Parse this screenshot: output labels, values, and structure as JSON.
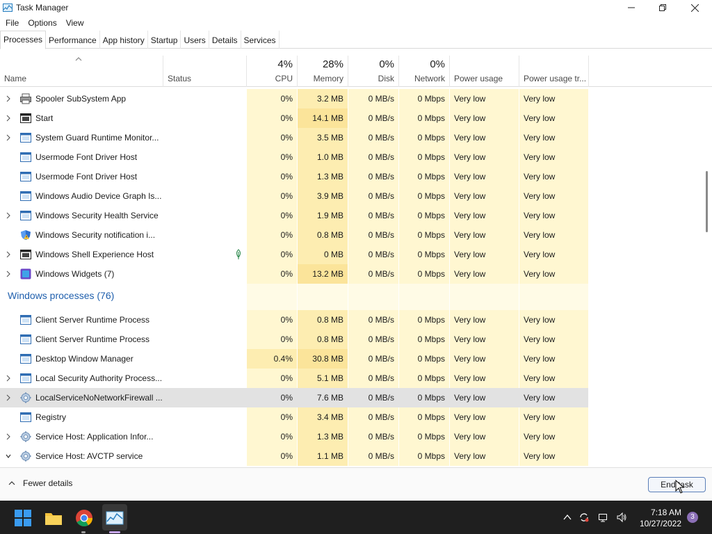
{
  "window": {
    "title": "Task Manager"
  },
  "menu": [
    "File",
    "Options",
    "View"
  ],
  "tabs": [
    "Processes",
    "Performance",
    "App history",
    "Startup",
    "Users",
    "Details",
    "Services"
  ],
  "columns": {
    "name": "Name",
    "status": "Status",
    "cpu": {
      "label": "CPU",
      "pct": "4%"
    },
    "memory": {
      "label": "Memory",
      "pct": "28%"
    },
    "disk": {
      "label": "Disk",
      "pct": "0%"
    },
    "network": {
      "label": "Network",
      "pct": "0%"
    },
    "power": "Power usage",
    "power_trend": "Power usage tr..."
  },
  "rows": [
    {
      "name": "Spooler SubSystem App",
      "expand": true,
      "icon": "printer-icon",
      "cpu": "0%",
      "mem": "3.2 MB",
      "disk": "0 MB/s",
      "net": "0 Mbps",
      "power": "Very low",
      "power_trend": "Very low"
    },
    {
      "name": "Start",
      "expand": true,
      "icon": "app-window-dark-icon",
      "cpu": "0%",
      "mem": "14.1 MB",
      "disk": "0 MB/s",
      "net": "0 Mbps",
      "power": "Very low",
      "power_trend": "Very low"
    },
    {
      "name": "System Guard Runtime Monitor...",
      "expand": true,
      "icon": "app-window-icon",
      "cpu": "0%",
      "mem": "3.5 MB",
      "disk": "0 MB/s",
      "net": "0 Mbps",
      "power": "Very low",
      "power_trend": "Very low"
    },
    {
      "name": "Usermode Font Driver Host",
      "expand": false,
      "icon": "app-window-icon",
      "cpu": "0%",
      "mem": "1.0 MB",
      "disk": "0 MB/s",
      "net": "0 Mbps",
      "power": "Very low",
      "power_trend": "Very low"
    },
    {
      "name": "Usermode Font Driver Host",
      "expand": false,
      "icon": "app-window-icon",
      "cpu": "0%",
      "mem": "1.3 MB",
      "disk": "0 MB/s",
      "net": "0 Mbps",
      "power": "Very low",
      "power_trend": "Very low"
    },
    {
      "name": "Windows Audio Device Graph Is...",
      "expand": false,
      "icon": "app-window-icon",
      "cpu": "0%",
      "mem": "3.9 MB",
      "disk": "0 MB/s",
      "net": "0 Mbps",
      "power": "Very low",
      "power_trend": "Very low"
    },
    {
      "name": "Windows Security Health Service",
      "expand": true,
      "icon": "app-window-icon",
      "cpu": "0%",
      "mem": "1.9 MB",
      "disk": "0 MB/s",
      "net": "0 Mbps",
      "power": "Very low",
      "power_trend": "Very low"
    },
    {
      "name": "Windows Security notification i...",
      "expand": false,
      "icon": "shield-icon",
      "cpu": "0%",
      "mem": "0.8 MB",
      "disk": "0 MB/s",
      "net": "0 Mbps",
      "power": "Very low",
      "power_trend": "Very low"
    },
    {
      "name": "Windows Shell Experience Host",
      "expand": true,
      "icon": "app-window-dark-icon",
      "leaf": true,
      "cpu": "0%",
      "mem": "0 MB",
      "disk": "0 MB/s",
      "net": "0 Mbps",
      "power": "Very low",
      "power_trend": "Very low"
    },
    {
      "name": "Windows Widgets (7)",
      "expand": true,
      "icon": "widgets-icon",
      "cpu": "0%",
      "mem": "13.2 MB",
      "disk": "0 MB/s",
      "net": "0 Mbps",
      "power": "Very low",
      "power_trend": "Very low"
    }
  ],
  "group": {
    "title": "Windows processes (76)"
  },
  "rows2": [
    {
      "name": "Client Server Runtime Process",
      "expand": false,
      "icon": "app-window-icon",
      "cpu": "0%",
      "mem": "0.8 MB",
      "disk": "0 MB/s",
      "net": "0 Mbps",
      "power": "Very low",
      "power_trend": "Very low"
    },
    {
      "name": "Client Server Runtime Process",
      "expand": false,
      "icon": "app-window-icon",
      "cpu": "0%",
      "mem": "0.8 MB",
      "disk": "0 MB/s",
      "net": "0 Mbps",
      "power": "Very low",
      "power_trend": "Very low"
    },
    {
      "name": "Desktop Window Manager",
      "expand": false,
      "icon": "app-window-icon",
      "cpu": "0.4%",
      "mem": "30.8 MB",
      "disk": "0 MB/s",
      "net": "0 Mbps",
      "power": "Very low",
      "power_trend": "Very low"
    },
    {
      "name": "Local Security Authority Process...",
      "expand": true,
      "icon": "app-window-icon",
      "cpu": "0%",
      "mem": "5.1 MB",
      "disk": "0 MB/s",
      "net": "0 Mbps",
      "power": "Very low",
      "power_trend": "Very low"
    },
    {
      "name": "LocalServiceNoNetworkFirewall ...",
      "expand": true,
      "icon": "gear-icon",
      "selected": true,
      "cpu": "0%",
      "mem": "7.6 MB",
      "disk": "0 MB/s",
      "net": "0 Mbps",
      "power": "Very low",
      "power_trend": "Very low"
    },
    {
      "name": "Registry",
      "expand": false,
      "icon": "app-window-icon",
      "cpu": "0%",
      "mem": "3.4 MB",
      "disk": "0 MB/s",
      "net": "0 Mbps",
      "power": "Very low",
      "power_trend": "Very low"
    },
    {
      "name": "Service Host: Application Infor...",
      "expand": true,
      "icon": "gear-icon",
      "cpu": "0%",
      "mem": "1.3 MB",
      "disk": "0 MB/s",
      "net": "0 Mbps",
      "power": "Very low",
      "power_trend": "Very low"
    },
    {
      "name": "Service Host: AVCTP service",
      "expand": true,
      "expanded": true,
      "icon": "gear-icon",
      "cpu": "0%",
      "mem": "1.1 MB",
      "disk": "0 MB/s",
      "net": "0 Mbps",
      "power": "Very low",
      "power_trend": "Very low"
    }
  ],
  "footer": {
    "fewer_details": "Fewer details",
    "end_task": "End task"
  },
  "taskbar": {
    "time": "7:18 AM",
    "date": "10/27/2022",
    "notifications": "3"
  },
  "colors": {
    "accent": "#1f5fad",
    "cpu_bg": "#fff7d1",
    "mem_bg": "#fdedb1",
    "selected": "#e2e2e2"
  }
}
